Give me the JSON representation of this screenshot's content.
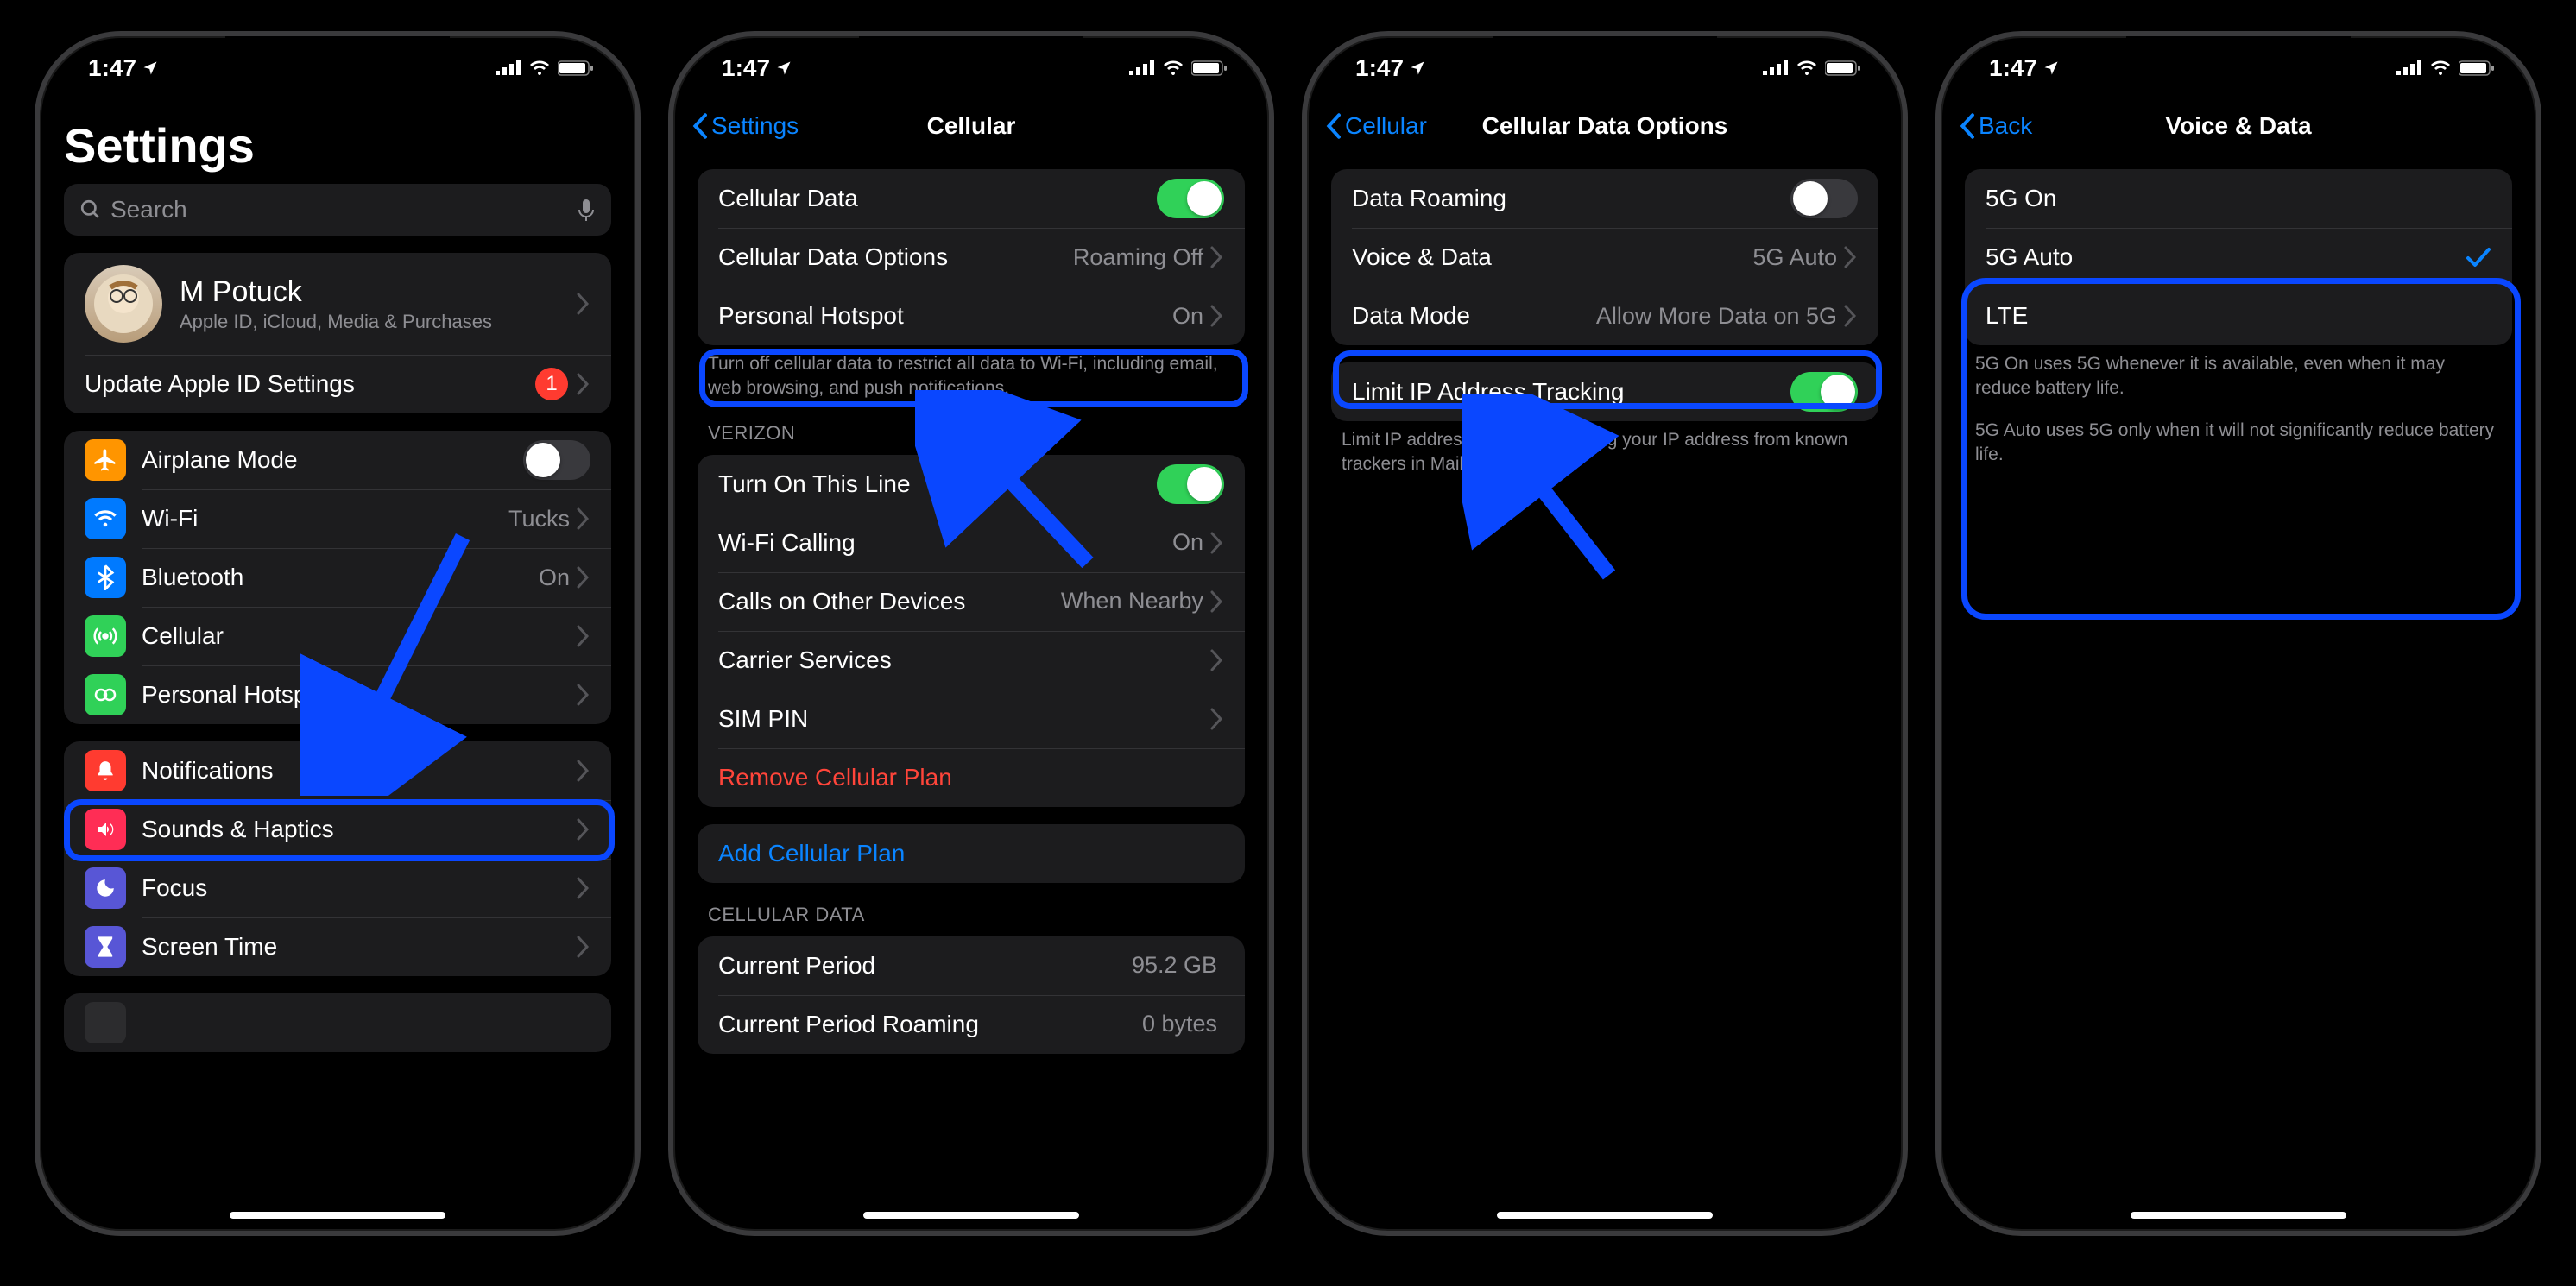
{
  "status": {
    "time": "1:47"
  },
  "phone1": {
    "title": "Settings",
    "search_placeholder": "Search",
    "profile": {
      "name": "M Potuck",
      "sub": "Apple ID, iCloud, Media & Purchases"
    },
    "update_row": {
      "label": "Update Apple ID Settings",
      "badge": "1"
    },
    "rows": {
      "airplane": "Airplane Mode",
      "wifi": "Wi-Fi",
      "wifi_val": "Tucks",
      "bluetooth": "Bluetooth",
      "bluetooth_val": "On",
      "cellular": "Cellular",
      "hotspot": "Personal Hotspot"
    },
    "rows2": {
      "notifications": "Notifications",
      "sounds": "Sounds & Haptics",
      "focus": "Focus",
      "screentime": "Screen Time"
    }
  },
  "phone2": {
    "back": "Settings",
    "title": "Cellular",
    "rows": {
      "data": "Cellular Data",
      "options": "Cellular Data Options",
      "options_val": "Roaming Off",
      "hotspot": "Personal Hotspot",
      "hotspot_val": "On"
    },
    "footer1": "Turn off cellular data to restrict all data to Wi-Fi, including email, web browsing, and push notifications.",
    "section2_header": "VERIZON",
    "rows2": {
      "turnon": "Turn On This Line",
      "wificall": "Wi-Fi Calling",
      "wificall_val": "On",
      "calls": "Calls on Other Devices",
      "calls_val": "When Nearby",
      "carrier": "Carrier Services",
      "simpin": "SIM PIN",
      "remove": "Remove Cellular Plan"
    },
    "add": "Add Cellular Plan",
    "section3_header": "CELLULAR DATA",
    "rows3": {
      "current": "Current Period",
      "current_val": "95.2 GB",
      "roaming": "Current Period Roaming",
      "roaming_val": "0 bytes"
    }
  },
  "phone3": {
    "back": "Cellular",
    "title": "Cellular Data Options",
    "rows": {
      "roaming": "Data Roaming",
      "voice": "Voice & Data",
      "voice_val": "5G Auto",
      "mode": "Data Mode",
      "mode_val": "Allow More Data on 5G"
    },
    "rows2": {
      "limit": "Limit IP Address Tracking"
    },
    "footer2": "Limit IP address tracking by hiding your IP address from known trackers in Mail and Safari."
  },
  "phone4": {
    "back": "Back",
    "title": "Voice & Data",
    "options": {
      "on": "5G On",
      "auto": "5G Auto",
      "lte": "LTE"
    },
    "footer1": "5G On uses 5G whenever it is available, even when it may reduce battery life.",
    "footer2": "5G Auto uses 5G only when it will not significantly reduce battery life."
  }
}
